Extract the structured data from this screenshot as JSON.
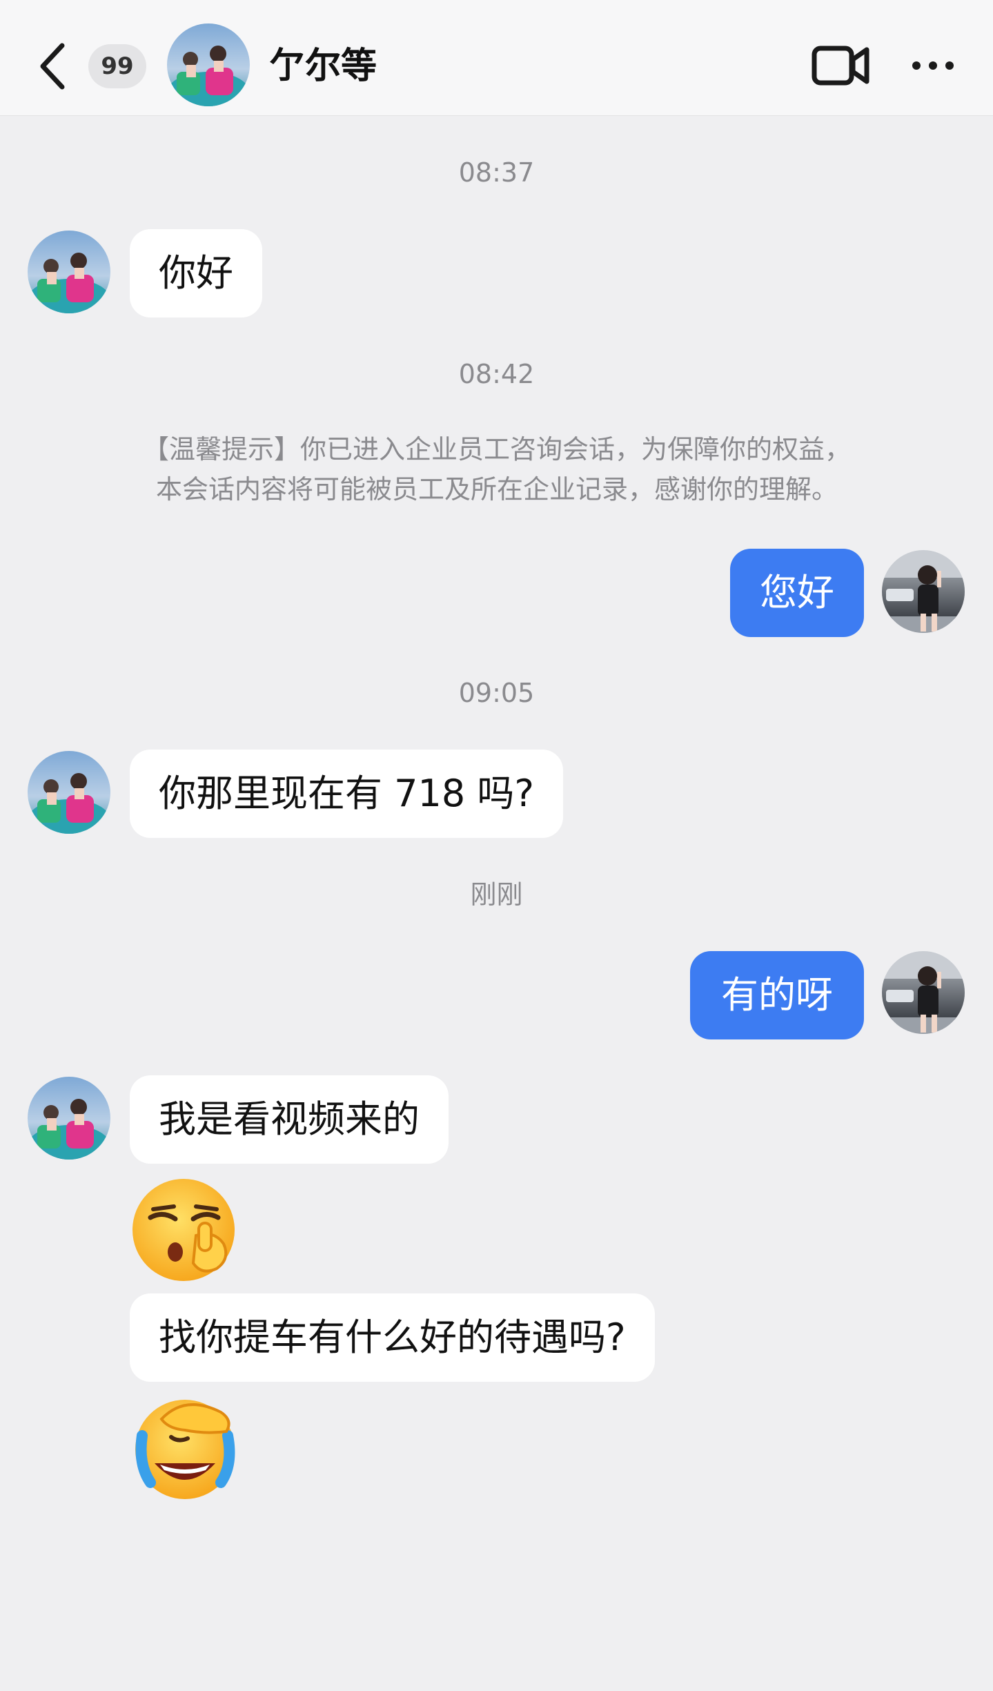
{
  "header": {
    "unread_count": "99",
    "title": "亇尔等",
    "icons": [
      "back-icon",
      "video-call-icon",
      "more-icon"
    ]
  },
  "colors": {
    "background": "#efeff1",
    "header_bg": "#f7f7f8",
    "outgoing_bubble": "#3d7cf2",
    "incoming_bubble": "#ffffff",
    "meta_text": "#8a8a8e"
  },
  "messages": {
    "time_1": "08:37",
    "msg_1": "你好",
    "time_2": "08:42",
    "notice_line1": "【温馨提示】你已进入企业员工咨询会话，为保障你的权益，",
    "notice_line2": "本会话内容将可能被员工及所在企业记录，感谢你的理解。",
    "msg_2": "您好",
    "time_3": "09:05",
    "msg_3": "你那里现在有 718 吗?",
    "time_4": "刚刚",
    "msg_4": "有的呀",
    "msg_5": "我是看视频来的",
    "msg_6_emoji": "shush-face-emoji",
    "msg_7": "找你提车有什么好的待遇吗?",
    "msg_8_emoji": "facepalm-crying-emoji"
  }
}
